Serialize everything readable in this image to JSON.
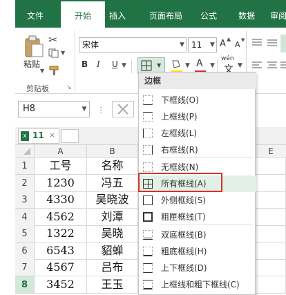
{
  "ribbon_tabs": [
    "文件",
    "开始",
    "插入",
    "页面布局",
    "公式",
    "数据",
    "审阅"
  ],
  "clipboard": {
    "paste_label": "粘贴",
    "group_label": "剪贴板"
  },
  "font": {
    "name": "宋体",
    "size": "11",
    "bold": "B",
    "italic": "I",
    "underline": "U",
    "grow": "A",
    "shrink": "A",
    "wen": "wén"
  },
  "name_box": "H8",
  "workbook_tab": "11",
  "columns": [
    "A",
    "B",
    "E"
  ],
  "rows": [
    {
      "num": "1",
      "a": "工号",
      "b": "名称"
    },
    {
      "num": "2",
      "a": "1230",
      "b": "冯五"
    },
    {
      "num": "3",
      "a": "4330",
      "b": "吴晓波"
    },
    {
      "num": "4",
      "a": "4562",
      "b": "刘潭"
    },
    {
      "num": "5",
      "a": "1322",
      "b": "吴晓"
    },
    {
      "num": "6",
      "a": "6543",
      "b": "貂蝉"
    },
    {
      "num": "7",
      "a": "4567",
      "b": "吕布"
    },
    {
      "num": "8",
      "a": "3452",
      "b": "王玉"
    }
  ],
  "border_menu": {
    "title": "边框",
    "items": [
      "下框线(O)",
      "上框线(P)",
      "左框线(L)",
      "右框线(R)",
      "无框线(N)",
      "所有框线(A)",
      "外侧框线(S)",
      "粗匣框线(T)",
      "双底框线(B)",
      "粗底框线(H)",
      "上下框线(D)",
      "上框线和粗下框线(C)"
    ],
    "highlighted_index": 5
  },
  "colors": {
    "accent": "#217346",
    "highlight_border": "#d9302b",
    "font_color": "#d9302b",
    "fill_color": "#ffe600"
  }
}
